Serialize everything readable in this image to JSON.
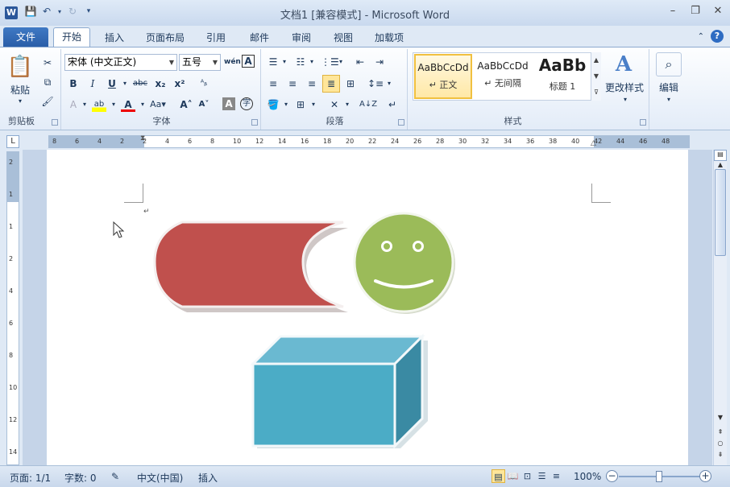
{
  "window": {
    "title": "文档1 [兼容模式] - Microsoft Word",
    "app_icon": "word-icon"
  },
  "tabs": [
    "文件",
    "开始",
    "插入",
    "页面布局",
    "引用",
    "邮件",
    "审阅",
    "视图",
    "加载项"
  ],
  "active_tab": "开始",
  "ribbon": {
    "clipboard": {
      "label": "剪贴板",
      "paste_label": "粘贴"
    },
    "font": {
      "label": "字体",
      "font_name": "宋体 (中文正文)",
      "font_size": "五号"
    },
    "paragraph": {
      "label": "段落"
    },
    "styles": {
      "label": "样式",
      "items": [
        {
          "sample": "AaBbCcDd",
          "name": "↵ 正文"
        },
        {
          "sample": "AaBbCcDd",
          "name": "↵ 无间隔"
        },
        {
          "sample": "AaBb",
          "name": "标题 1"
        }
      ],
      "change_styles_label": "更改样式"
    },
    "editing": {
      "label": "编辑"
    }
  },
  "ruler": {
    "horizontal_ticks": [
      "8",
      "6",
      "4",
      "2",
      "2",
      "4",
      "6",
      "8",
      "10",
      "12",
      "14",
      "16",
      "18",
      "20",
      "22",
      "24",
      "26",
      "28",
      "30",
      "32",
      "34",
      "36",
      "38",
      "40",
      "42",
      "44",
      "46",
      "48"
    ],
    "vertical_ticks": [
      "2",
      "1",
      "1",
      "2",
      "4",
      "6",
      "8",
      "10",
      "12",
      "14"
    ]
  },
  "document": {
    "paragraph_mark": "↵",
    "shapes": [
      {
        "type": "flowchart-stored-data",
        "fill": "#c0504d"
      },
      {
        "type": "smiley-face",
        "fill": "#9bbb59"
      },
      {
        "type": "cube",
        "fill": "#4bacc6"
      }
    ]
  },
  "statusbar": {
    "page": "页面: 1/1",
    "words": "字数: 0",
    "language": "中文(中国)",
    "mode": "插入",
    "zoom": "100%"
  },
  "colors": {
    "accent": "#2b579a",
    "ribbon_bg": "#dfe9f5",
    "highlight": "#ffe69a"
  }
}
